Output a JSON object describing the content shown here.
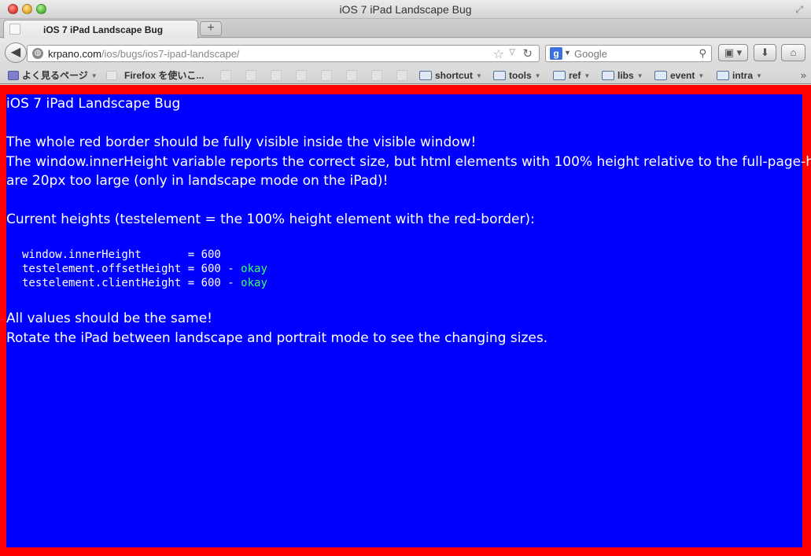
{
  "window": {
    "title": "iOS 7 iPad Landscape Bug"
  },
  "tab": {
    "label": "iOS 7 iPad Landscape Bug",
    "new_tab_label": "+"
  },
  "navbar": {
    "back_icon": "◀",
    "url_host": "krpano.com",
    "url_path": "/ios/bugs/ios7-ipad-landscape/",
    "search_engine_letter": "g",
    "search_placeholder": "Google"
  },
  "bookmarks": {
    "items": [
      {
        "label": "よく見るページ",
        "has_arrow": true
      },
      {
        "label": "Firefox を使いこ...",
        "has_arrow": false
      },
      {
        "label": "shortcut",
        "has_arrow": true
      },
      {
        "label": "tools",
        "has_arrow": true
      },
      {
        "label": "ref",
        "has_arrow": true
      },
      {
        "label": "libs",
        "has_arrow": true
      },
      {
        "label": "event",
        "has_arrow": true
      },
      {
        "label": "intra",
        "has_arrow": true
      }
    ],
    "more_icon": "»"
  },
  "page": {
    "title": "iOS 7 iPad Landscape Bug",
    "line1": "The whole red border should be fully visible inside the visible window!",
    "line2": "The window.innerHeight variable reports the correct size, but html elements with 100% height relative to the full-page-height",
    "line3": "are 20px too large (only in landscape mode on the iPad)!",
    "heights_intro": "Current heights (testelement = the 100% height element with the red-border):",
    "heights": [
      {
        "label": "window.innerHeight       = 600",
        "status": ""
      },
      {
        "label": "testelement.offsetHeight = 600 - ",
        "status": "okay"
      },
      {
        "label": "testelement.clientHeight = 600 - ",
        "status": "okay"
      }
    ],
    "outro1": "All values should be the same!",
    "outro2": "Rotate the iPad between landscape and portrait mode to see the changing sizes."
  },
  "colors": {
    "border": "#ff0000",
    "background": "#0000ff",
    "text": "#ffffff",
    "okay": "#33ff66"
  }
}
